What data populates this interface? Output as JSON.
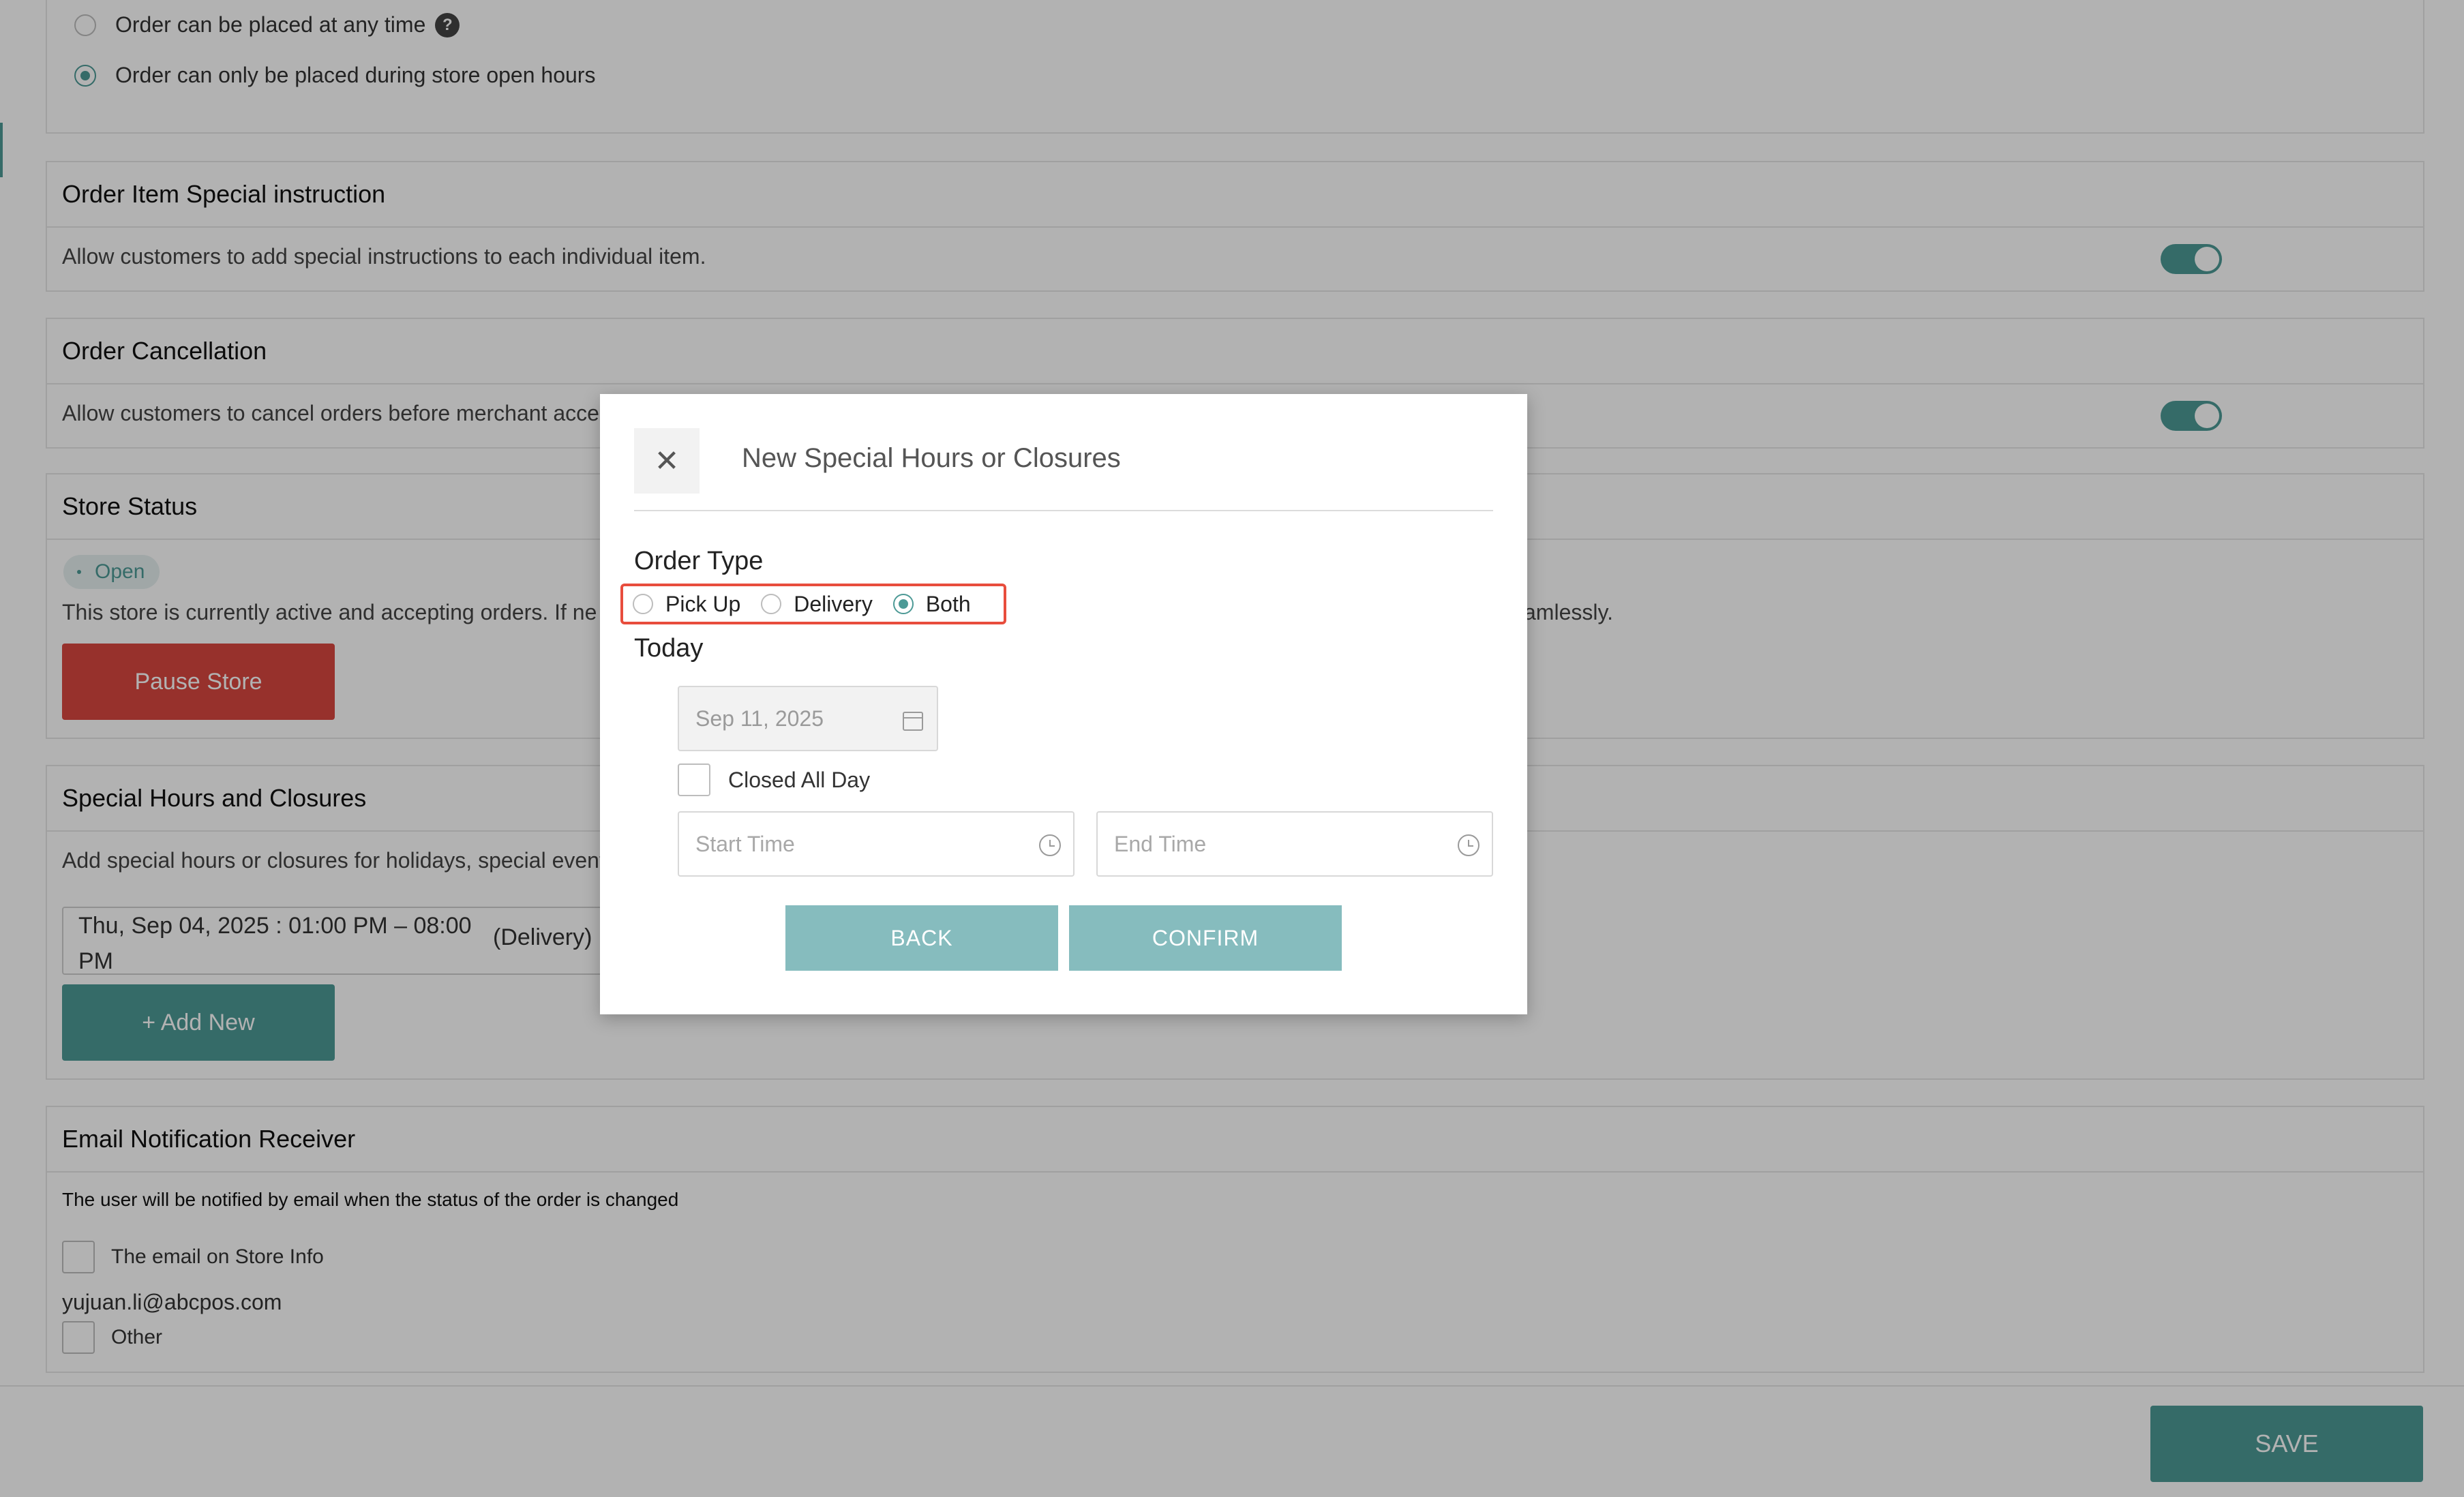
{
  "order_timing": {
    "option_any_time": "Order can be placed at any time",
    "option_open_hours": "Order can only be placed during store open hours",
    "help_glyph": "?"
  },
  "special_instruction": {
    "title": "Order Item Special instruction",
    "description": "Allow customers to add special instructions to each individual item.",
    "enabled": true
  },
  "cancellation": {
    "title": "Order Cancellation",
    "description": "Allow customers to cancel orders before merchant acce",
    "enabled": true
  },
  "store_status": {
    "title": "Store Status",
    "status": "Open",
    "description_left": "This store is currently active and accepting orders. If ne",
    "description_right": "amlessly.",
    "pause_button": "Pause Store"
  },
  "special_hours": {
    "title": "Special Hours and Closures",
    "description": "Add special hours or closures for holidays, special event",
    "entry_date": "Thu, Sep 04, 2025 : 01:00 PM – 08:00 PM",
    "entry_type": "(Delivery)",
    "add_button": "+ Add New"
  },
  "email_receiver": {
    "title": "Email Notification Receiver",
    "description": "The user will be notified by email when the status of the order is changed",
    "store_email_label": "The email on Store Info",
    "store_email": "yujuan.li@abcpos.com",
    "other_label": "Other"
  },
  "footer": {
    "save_label": "SAVE"
  },
  "modal": {
    "title": "New Special Hours or Closures",
    "close_glyph": "✕",
    "order_type_label": "Order Type",
    "order_types": [
      "Pick Up",
      "Delivery",
      "Both"
    ],
    "selected_order_type": "Both",
    "day_label": "Today",
    "date_placeholder": "Sep 11, 2025",
    "closed_all_day_label": "Closed All Day",
    "start_time_placeholder": "Start Time",
    "end_time_placeholder": "End Time",
    "back_label": "BACK",
    "confirm_label": "CONFIRM"
  },
  "colors": {
    "accent": "#4d9a96",
    "danger": "#d94740",
    "modal_button": "#86bcbe",
    "highlight_box": "#e84d3d"
  }
}
